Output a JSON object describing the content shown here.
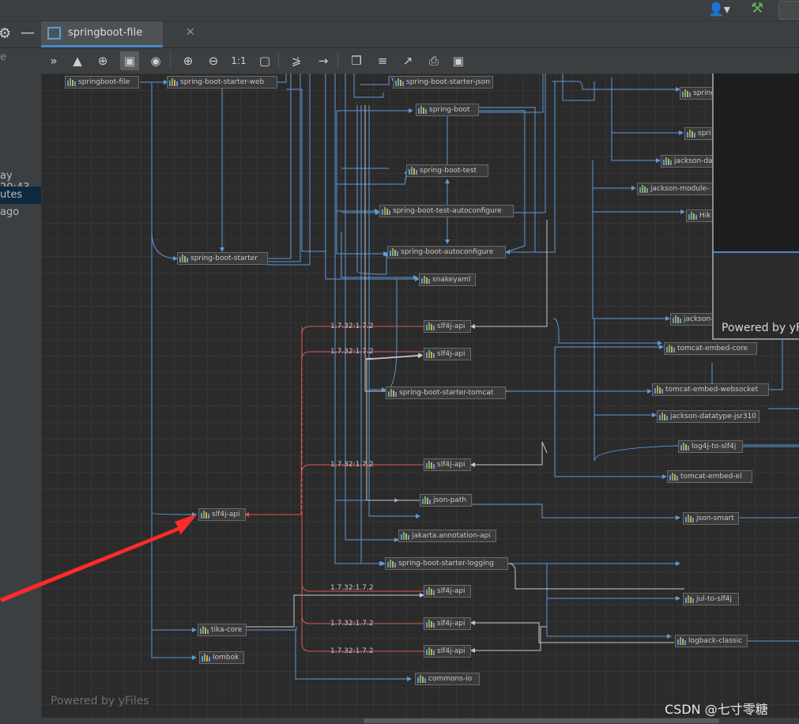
{
  "window": {
    "tab_title": "springboot-file"
  },
  "left_panel": {
    "fragment_e": "e",
    "fragment_time": "ay 20:43",
    "fragment_ago": "utes ago"
  },
  "toolbar": {
    "buttons": [
      "expand-dependencies",
      "show-neighbors",
      "select-tool",
      "fit-content",
      "show-hide",
      "zoom-in",
      "zoom-out",
      "actual-size",
      "fit-page",
      "layout",
      "route-edges",
      "copy",
      "export-text",
      "open-in-new",
      "print",
      "save"
    ],
    "actual_size_label": "1:1"
  },
  "diagram": {
    "nodes": {
      "springboot_file": "springboot-file",
      "starter_web": "spring-boot-starter-web",
      "starter_json": "spring-boot-starter-json",
      "spring_boot": "spring-boot",
      "spring_top1": "spring",
      "spring_top2": "spri",
      "jackson_da": "jackson-da",
      "jackson_module": "jackson-module-",
      "hik": "Hik",
      "boot_test": "spring-boot-test",
      "test_autoconfigure": "spring-boot-test-autoconfigure",
      "starter": "spring-boot-starter",
      "autoconfigure": "spring-boot-autoconfigure",
      "snakeyaml": "snakeyaml",
      "jackson_mid": "jackson-",
      "slf4j_1": "slf4j-api",
      "slf4j_2": "slf4j-api",
      "tomcat_core": "tomcat-embed-core",
      "starter_tomcat": "spring-boot-starter-tomcat",
      "tomcat_websocket": "tomcat-embed-websocket",
      "jsr310": "jackson-datatype-jsr310",
      "log4j": "log4j-to-slf4j",
      "slf4j_3": "slf4j-api",
      "tomcat_el": "tomcat-embed-el",
      "json_path": "json-path",
      "slf4j_main": "slf4j-api",
      "json_smart": "json-smart",
      "jakarta": "jakarta.annotation-api",
      "starter_logging": "spring-boot-starter-logging",
      "slf4j_4": "slf4j-api",
      "jul": "jul-to-slf4j",
      "tika": "tika-core",
      "slf4j_5": "slf4j-api",
      "logback": "logback-classic",
      "lombok": "lombok",
      "slf4j_6": "slf4j-api",
      "commons_io": "commons-io"
    },
    "version_labels": [
      "1.7.32:1.7.2",
      "1.7.32:1.7.2",
      "1.7.32:1.7.2",
      "1.7.32:1.7.2",
      "1.7.32:1.7.2",
      "1.7.32:1.7.2"
    ],
    "powered_by": "Powered by yFiles",
    "overview_powered_by": "Powered by yF"
  },
  "watermark": "CSDN @七寸零糖",
  "colors": {
    "edge": "#5e9ad9",
    "edge_alt": "#c8c8c8",
    "conflict": "#e05555",
    "tab_underline": "#4a88c7",
    "annotation_arrow": "#ff2a2a"
  }
}
